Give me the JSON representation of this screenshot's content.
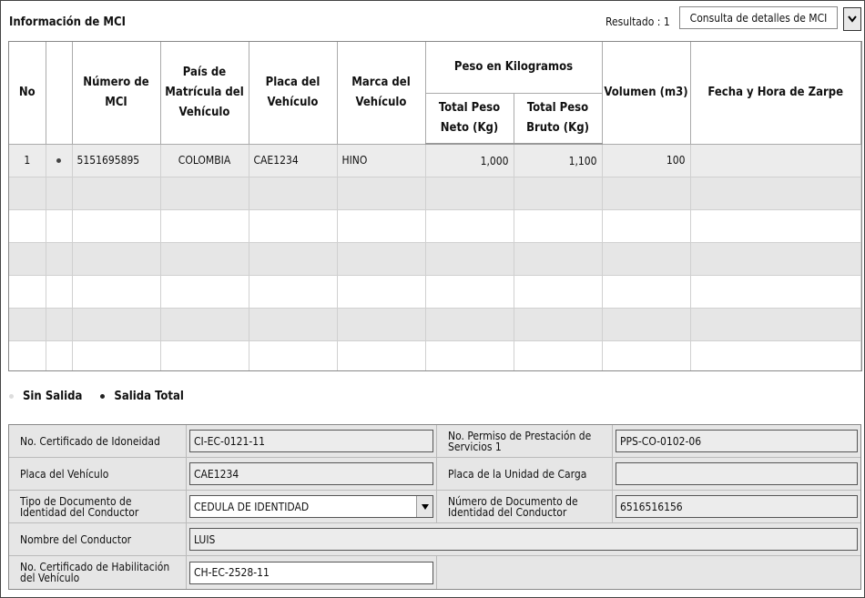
{
  "panel": {
    "title": "Información de MCI"
  },
  "results": {
    "label": "Resultado : 1"
  },
  "query": {
    "button_label": "Consulta de detalles de MCI"
  },
  "grid": {
    "headers": {
      "no": "No",
      "mci_number": "Número de MCI",
      "country": "País de Matrícula del Vehículo",
      "plate": "Placa del Vehículo",
      "brand": "Marca del Vehículo",
      "weight_group": "Peso en Kilogramos",
      "net_weight": "Total Peso Neto (Kg)",
      "gross_weight": "Total Peso Bruto (Kg)",
      "volume": "Volumen (m3)",
      "departure": "Fecha y Hora de Zarpe"
    },
    "rows": [
      {
        "no": "1",
        "mci_number": "5151695895",
        "country": "COLOMBIA",
        "plate": "CAE1234",
        "brand": "HINO",
        "net_weight": "1,000",
        "gross_weight": "1,100",
        "volume": "100",
        "departure": ""
      }
    ]
  },
  "legend": {
    "no_exit": "Sin Salida",
    "total_exit": "Salida Total"
  },
  "form": {
    "cert_idoneidad_label": "No. Certificado de Idoneidad",
    "cert_idoneidad_value": "CI-EC-0121-11",
    "permiso_label": "No. Permiso de Prestación de Servicios 1",
    "permiso_value": "PPS-CO-0102-06",
    "placa_label": "Placa del Vehículo",
    "placa_value": "CAE1234",
    "placa_carga_label": "Placa de la Unidad de Carga",
    "placa_carga_value": "",
    "tipo_doc_label": "Tipo de Documento de Identidad del Conductor",
    "tipo_doc_value": "CEDULA DE IDENTIDAD",
    "num_doc_label": "Número de Documento de Identidad del Conductor",
    "num_doc_value": "6516516156",
    "nombre_label": "Nombre del Conductor",
    "nombre_value": "LUIS",
    "cert_hab_label": "No. Certificado de Habilitación del Vehículo",
    "cert_hab_value": "CH-EC-2528-11"
  }
}
